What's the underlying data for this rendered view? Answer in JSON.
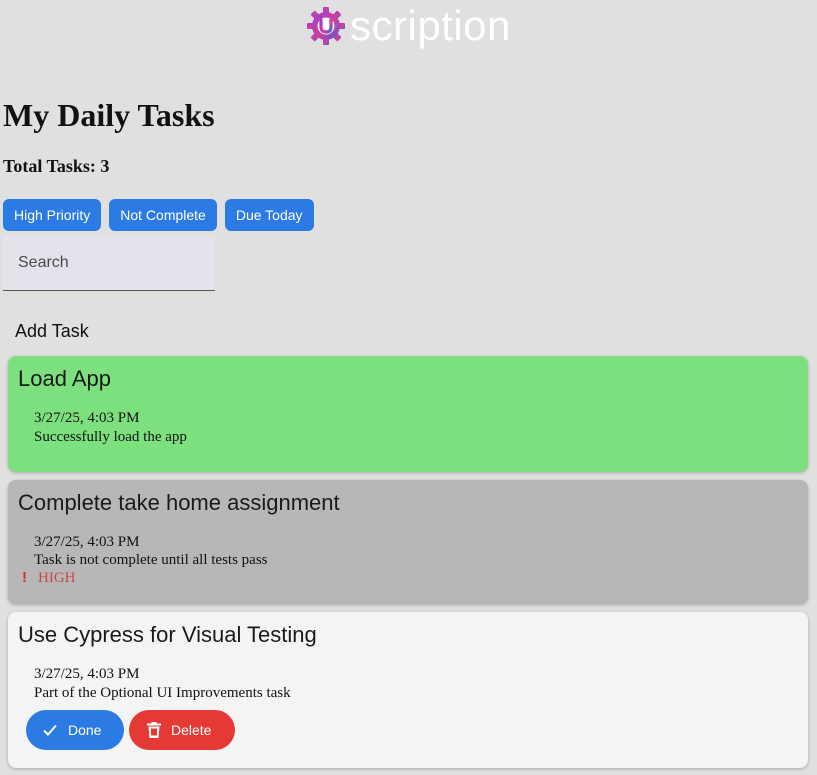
{
  "brand": {
    "logo_text": "scription"
  },
  "page": {
    "title": "My Daily Tasks",
    "total_label": "Total Tasks: 3"
  },
  "filters": [
    {
      "label": "High Priority"
    },
    {
      "label": "Not Complete"
    },
    {
      "label": "Due Today"
    }
  ],
  "search": {
    "placeholder": "Search",
    "value": ""
  },
  "add_task_label": "Add Task",
  "tasks": [
    {
      "title": "Load App",
      "date": "3/27/25, 4:03 PM",
      "description": "Successfully load the app",
      "state": "complete",
      "bg_color": "#7ce07e"
    },
    {
      "title": "Complete take home assignment",
      "date": "3/27/25, 4:03 PM",
      "description": "Task is not complete until all tests pass",
      "priority_label": "HIGH",
      "state": "high-priority",
      "bg_color": "#b8b6b7"
    },
    {
      "title": "Use Cypress for Visual Testing",
      "date": "3/27/25, 4:03 PM",
      "description": "Part of the Optional UI Improvements task",
      "state": "active",
      "bg_color": "#f4f4f4",
      "done_label": "Done",
      "delete_label": "Delete"
    }
  ],
  "colors": {
    "primary": "#2c7be5",
    "danger": "#e53935",
    "page_bg": "#e0e0e0",
    "priority_text": "#c9474b"
  },
  "icons": [
    "logo-gear-icon",
    "exclamation-icon",
    "check-icon",
    "trash-icon"
  ]
}
